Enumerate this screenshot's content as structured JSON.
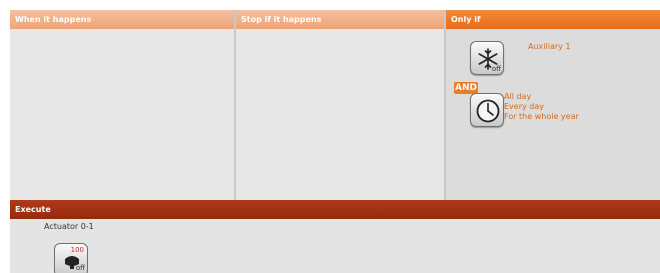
{
  "panels": {
    "when": {
      "header": "When it happens"
    },
    "stop": {
      "header": "Stop if it happens"
    },
    "only_if": {
      "header": "Only if",
      "conditions": [
        {
          "icon": "snowflake-icon",
          "state": "off",
          "lines": [
            "Auxiliary 1"
          ]
        },
        {
          "icon": "clock-icon",
          "state": "",
          "lines": [
            "All day",
            "Every day",
            "For the whole year"
          ]
        }
      ],
      "and_label": "AND"
    }
  },
  "execute": {
    "header": "Execute",
    "actuator": {
      "name": "Actuator 0-1",
      "value": "100",
      "state": "off"
    }
  },
  "colors": {
    "accent": "#ee7a22",
    "header_light": "#eea37a",
    "execute_header": "#a0301a",
    "condition_text": "#d46b1c"
  }
}
